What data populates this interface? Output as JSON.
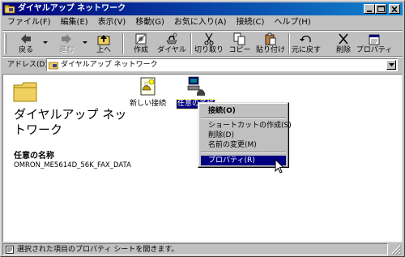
{
  "window": {
    "title": "ダイヤルアップ ネットワーク",
    "controls": {
      "minimize": "minimize",
      "maximize": "maximize",
      "close": "close"
    }
  },
  "menu": [
    "ファイル(F)",
    "編集(E)",
    "表示(V)",
    "移動(G)",
    "お気に入り(A)",
    "接続(C)",
    "ヘルプ(H)"
  ],
  "toolbar": {
    "back": "戻る",
    "forward": "進む",
    "up": "上へ",
    "create": "作成",
    "dial": "ダイヤル",
    "cut": "切り取り",
    "copy": "コピー",
    "paste": "貼り付け",
    "undo": "元に戻す",
    "delete": "削除",
    "properties": "プロパティ"
  },
  "address": {
    "label": "アドレス(D)",
    "value": "ダイヤルアップ ネットワーク"
  },
  "left_pane": {
    "title": "ダイヤルアップ ネットワーク",
    "selected_label": "任意の名称",
    "selected_value": "OMRON_ME5614D_56K_FAX_DATA"
  },
  "items": [
    {
      "label": "新しい接続",
      "icon": "new-connection-icon"
    },
    {
      "label": "任意の名称",
      "icon": "dialup-connection-icon",
      "selected": true
    }
  ],
  "context_menu": {
    "connect": "接続(O)",
    "create_shortcut": "ショートカットの作成(S)",
    "delete": "削除(D)",
    "rename": "名前の変更(M)",
    "properties": "プロパティ(R)"
  },
  "status": {
    "text": "選択された項目のプロパティ シートを開きます。"
  },
  "colors": {
    "title_start": "#00007b",
    "title_end": "#1084d0",
    "highlight": "#000080",
    "face": "#c0c0c0"
  }
}
